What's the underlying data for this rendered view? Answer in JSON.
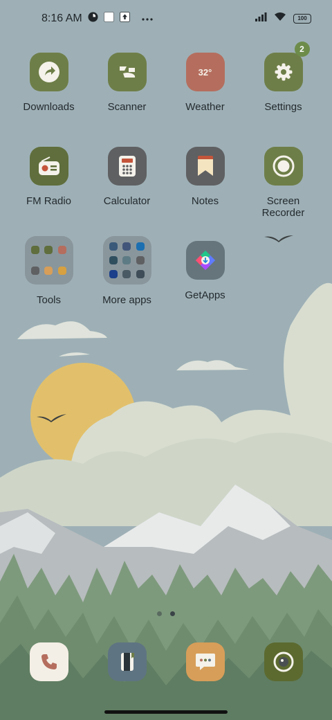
{
  "status_bar": {
    "time": "8:16 AM",
    "battery": "100",
    "icons": [
      "data-saver-icon",
      "notification-square-icon",
      "upload-icon",
      "more-dots-icon",
      "signal-icon",
      "wifi-icon",
      "battery-icon"
    ]
  },
  "apps": [
    {
      "id": "downloads",
      "label": "Downloads",
      "icon": "download-arrow-icon",
      "bg": "#6e7e48"
    },
    {
      "id": "scanner",
      "label": "Scanner",
      "icon": "scan-icon",
      "bg": "#6e7e48"
    },
    {
      "id": "weather",
      "label": "Weather",
      "icon_text": "32°",
      "bg": "#b56e5e"
    },
    {
      "id": "settings",
      "label": "Settings",
      "icon": "gear-icon",
      "bg": "#6e7e48",
      "badge": "2"
    },
    {
      "id": "fm-radio",
      "label": "FM Radio",
      "icon": "radio-icon",
      "bg": "#5f6e3c"
    },
    {
      "id": "calculator",
      "label": "Calculator",
      "icon": "calculator-icon",
      "bg": "#5f6062"
    },
    {
      "id": "notes",
      "label": "Notes",
      "icon": "note-icon",
      "bg": "#5f6062"
    },
    {
      "id": "screen-recorder",
      "label": "Screen Recorder",
      "icon": "record-icon",
      "bg": "#6e7e48"
    },
    {
      "id": "tools",
      "label": "Tools",
      "icon": "folder-icon"
    },
    {
      "id": "more-apps",
      "label": "More apps",
      "icon": "folder-icon"
    },
    {
      "id": "getapps",
      "label": "GetApps",
      "icon": "getapps-icon",
      "bg": "#66757c"
    }
  ],
  "dock": [
    {
      "id": "phone",
      "icon": "phone-icon",
      "bg": "#f4efe6"
    },
    {
      "id": "contacts",
      "icon": "contacts-icon",
      "bg": "#5f7482"
    },
    {
      "id": "messages",
      "icon": "message-icon",
      "bg": "#d79e59"
    },
    {
      "id": "camera",
      "icon": "camera-icon",
      "bg": "#5c6a30"
    }
  ],
  "pages": {
    "count": 2,
    "active": 2
  }
}
